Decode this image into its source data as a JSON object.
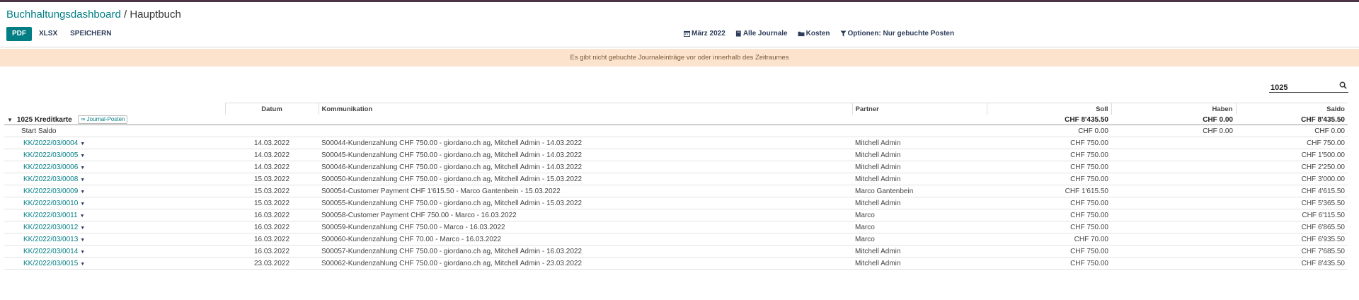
{
  "breadcrumb": {
    "root": "Buchhaltungsdashboard",
    "separator": " / ",
    "current": "Hauptbuch"
  },
  "actions": {
    "pdf": "PDF",
    "xlsx": "XLSX",
    "save": "SPEICHERN"
  },
  "filters": {
    "period": "März 2022",
    "journals": "Alle Journale",
    "costs": "Kosten",
    "options": "Optionen: Nur gebuchte Posten"
  },
  "warning": "Es gibt nicht gebuchte Journaleinträge vor oder innerhalb des Zeitraumes",
  "search": {
    "value": "1025"
  },
  "table": {
    "headers": {
      "date": "Datum",
      "communication": "Kommunikation",
      "partner": "Partner",
      "debit": "Soll",
      "credit": "Haben",
      "balance": "Saldo"
    },
    "group": {
      "label": "1025 Kreditkarte",
      "journal_button": "⇒ Journal-Posten",
      "debit": "CHF 8'435.50",
      "credit": "CHF 0.00",
      "balance": "CHF 8'435.50"
    },
    "start": {
      "label": "Start Saldo",
      "debit": "CHF 0.00",
      "credit": "CHF 0.00",
      "balance": "CHF 0.00"
    },
    "rows": [
      {
        "ref": "KK/2022/03/0004",
        "date": "14.03.2022",
        "communication": "S00044-Kundenzahlung CHF 750.00 - giordano.ch ag, Mitchell Admin - 14.03.2022",
        "partner": "Mitchell Admin",
        "debit": "CHF 750.00",
        "balance": "CHF 750.00"
      },
      {
        "ref": "KK/2022/03/0005",
        "date": "14.03.2022",
        "communication": "S00045-Kundenzahlung CHF 750.00 - giordano.ch ag, Mitchell Admin - 14.03.2022",
        "partner": "Mitchell Admin",
        "debit": "CHF 750.00",
        "balance": "CHF 1'500.00"
      },
      {
        "ref": "KK/2022/03/0006",
        "date": "14.03.2022",
        "communication": "S00046-Kundenzahlung CHF 750.00 - giordano.ch ag, Mitchell Admin - 14.03.2022",
        "partner": "Mitchell Admin",
        "debit": "CHF 750.00",
        "balance": "CHF 2'250.00"
      },
      {
        "ref": "KK/2022/03/0008",
        "date": "15.03.2022",
        "communication": "S00050-Kundenzahlung CHF 750.00 - giordano.ch ag, Mitchell Admin - 15.03.2022",
        "partner": "Mitchell Admin",
        "debit": "CHF 750.00",
        "balance": "CHF 3'000.00"
      },
      {
        "ref": "KK/2022/03/0009",
        "date": "15.03.2022",
        "communication": "S00054-Customer Payment CHF 1'615.50 - Marco Gantenbein - 15.03.2022",
        "partner": "Marco Gantenbein",
        "debit": "CHF 1'615.50",
        "balance": "CHF 4'615.50"
      },
      {
        "ref": "KK/2022/03/0010",
        "date": "15.03.2022",
        "communication": "S00055-Kundenzahlung CHF 750.00 - giordano.ch ag, Mitchell Admin - 15.03.2022",
        "partner": "Mitchell Admin",
        "debit": "CHF 750.00",
        "balance": "CHF 5'365.50"
      },
      {
        "ref": "KK/2022/03/0011",
        "date": "16.03.2022",
        "communication": "S00058-Customer Payment CHF 750.00 - Marco - 16.03.2022",
        "partner": "Marco",
        "debit": "CHF 750.00",
        "balance": "CHF 6'115.50"
      },
      {
        "ref": "KK/2022/03/0012",
        "date": "16.03.2022",
        "communication": "S00059-Kundenzahlung CHF 750.00 - Marco - 16.03.2022",
        "partner": "Marco",
        "debit": "CHF 750.00",
        "balance": "CHF 6'865.50"
      },
      {
        "ref": "KK/2022/03/0013",
        "date": "16.03.2022",
        "communication": "S00060-Kundenzahlung CHF 70.00 - Marco - 16.03.2022",
        "partner": "Marco",
        "debit": "CHF 70.00",
        "balance": "CHF 6'935.50"
      },
      {
        "ref": "KK/2022/03/0014",
        "date": "16.03.2022",
        "communication": "S00057-Kundenzahlung CHF 750.00 - giordano.ch ag, Mitchell Admin - 16.03.2022",
        "partner": "Mitchell Admin",
        "debit": "CHF 750.00",
        "balance": "CHF 7'685.50"
      },
      {
        "ref": "KK/2022/03/0015",
        "date": "23.03.2022",
        "communication": "S00062-Kundenzahlung CHF 750.00 - giordano.ch ag, Mitchell Admin - 23.03.2022",
        "partner": "Mitchell Admin",
        "debit": "CHF 750.00",
        "balance": "CHF 8'435.50"
      }
    ]
  }
}
